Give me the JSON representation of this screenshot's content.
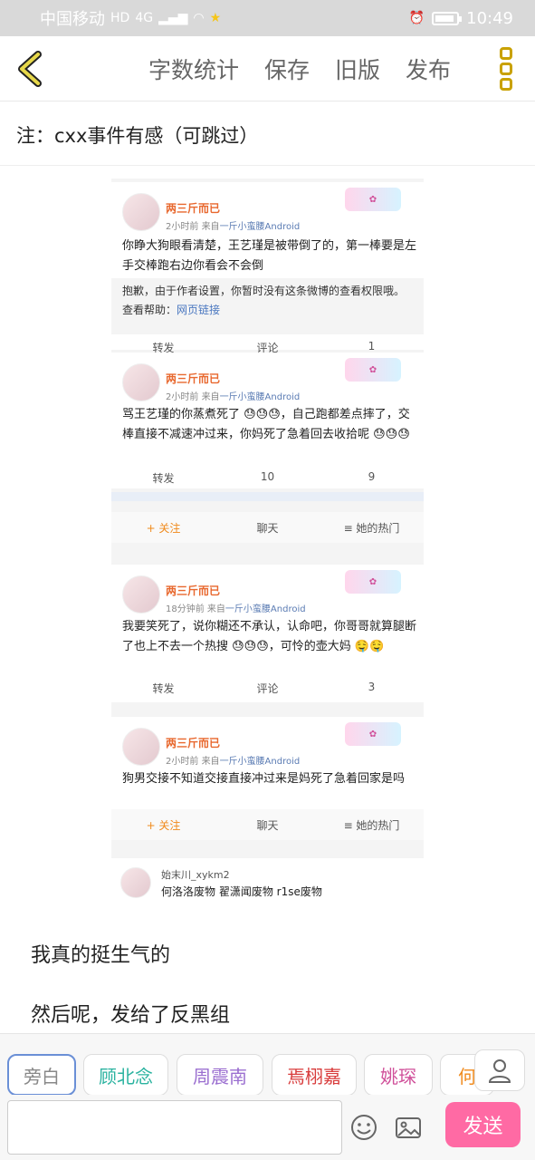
{
  "status_bar": {
    "carrier": "中国移动",
    "network": "4G",
    "time": "10:49"
  },
  "toolbar": {
    "word_count": "字数统计",
    "save": "保存",
    "old_version": "旧版",
    "publish": "发布"
  },
  "note": "注：cxx事件有感（可跳过）",
  "screenshot": {
    "posts": [
      {
        "name": "两三斤而已",
        "time": "2小时前",
        "source_prefix": "来自",
        "source": "一斤小蛮腰Android",
        "text": "你睁大狗眼看清楚，王艺瑾是被带倒了的，第一棒要是左手交棒跑右边你看会不会倒",
        "quote_text": "抱歉，由于作者设置，你暂时没有这条微博的查看权限哦。查看帮助：",
        "quote_link": "网页链接",
        "repost": "转发",
        "comment": "评论",
        "likes": "1"
      },
      {
        "name": "两三斤而已",
        "time": "2小时前",
        "source_prefix": "来自",
        "source": "一斤小蛮腰Android",
        "text": "骂王艺瑾的你蒸煮死了 😓😓😓，自己跑都差点摔了，交棒直接不减速冲过来，你妈死了急着回去收拾呢 😓😓😓",
        "repost": "转发",
        "comment": "10",
        "likes": "9"
      },
      {
        "name": "两三斤而已",
        "time": "18分钟前",
        "source_prefix": "来自",
        "source": "一斤小蛮腰Android",
        "text": "我要笑死了，说你糊还不承认，认命吧，你哥哥就算腿断了也上不去一个热搜 😓😓😓，可怜的壶大妈 🤤🤤",
        "repost": "转发",
        "comment": "评论",
        "likes": "3"
      },
      {
        "name": "两三斤而已",
        "time": "2小时前",
        "source_prefix": "来自",
        "source": "一斤小蛮腰Android",
        "text": "狗男交接不知道交接直接冲过来是妈死了急着回家是吗"
      }
    ],
    "follow_bar": {
      "follow": "+ 关注",
      "chat": "聊天",
      "hot": "≡ 她的热门"
    },
    "comment": {
      "name": "始末川_xykm2",
      "text": "何洛洛废物 翟潇闻废物 r1se废物"
    }
  },
  "paragraphs": [
    "我真的挺生气的",
    "然后呢，发给了反黑组"
  ],
  "characters": [
    "旁白",
    "顾北念",
    "周震南",
    "焉栩嘉",
    "姚琛",
    "何"
  ],
  "colors": {
    "chip_text": [
      "#888888",
      "#2bb3a0",
      "#9b6fd0",
      "#d83a3a",
      "#d0509a",
      "#f08a1c"
    ],
    "send": "#ff6aa4",
    "accent": "#c9a100"
  },
  "input": {
    "placeholder": "",
    "send": "发送"
  }
}
